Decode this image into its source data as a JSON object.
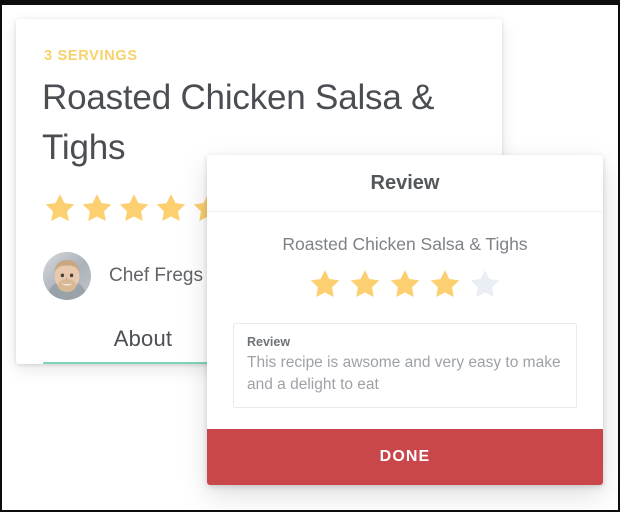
{
  "colors": {
    "accent_yellow": "#f8d16a",
    "star_filled": "#fcd071",
    "star_empty": "#e9eef4",
    "tab_underline_teal": "#7fd4b4",
    "done_button_red": "#c9464b",
    "title_text": "#4a4d52",
    "frame_border": "#0d0d0d"
  },
  "recipe_card": {
    "servings_label": "3 SERVINGS",
    "title": "Roasted Chicken Salsa & Tighs",
    "rating": {
      "value": 5,
      "max": 5,
      "icon": "star-icon"
    },
    "chef": {
      "avatar_icon": "chef-avatar",
      "name": "Chef Fregs"
    },
    "tabs": [
      {
        "label": "About",
        "active": true
      }
    ]
  },
  "review_modal": {
    "title": "Review",
    "recipe_name": "Roasted Chicken Salsa & Tighs",
    "rating": {
      "value": 4,
      "max": 5,
      "icon": "star-icon"
    },
    "review_field": {
      "label": "Review",
      "value": "This recipe is awsome and very easy to make and a delight to eat",
      "placeholder": "Review"
    },
    "done_label": "DONE"
  }
}
